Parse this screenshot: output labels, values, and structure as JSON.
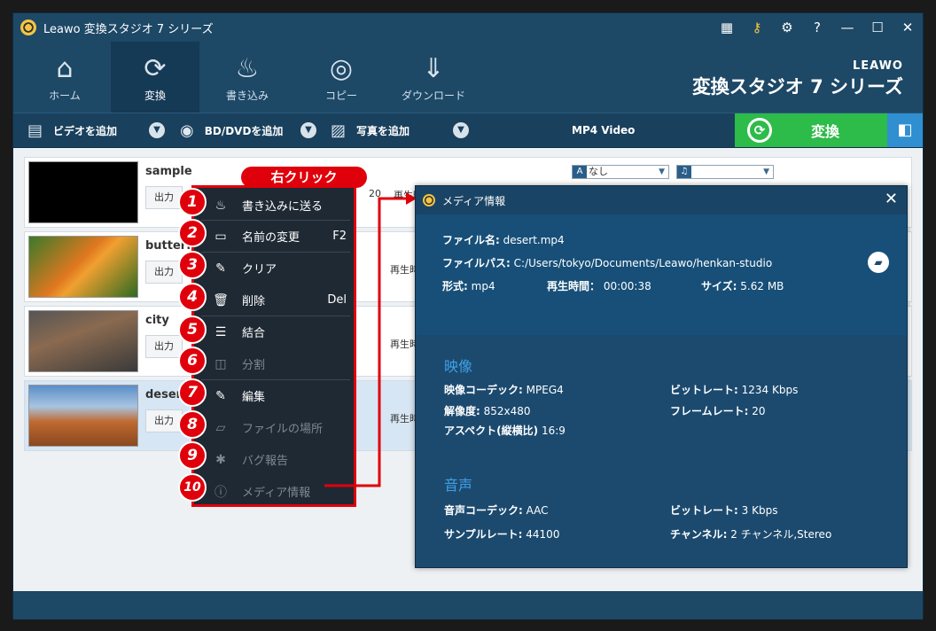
{
  "app": {
    "title": "Leawo 変換スタジオ 7 シリーズ"
  },
  "nav": [
    {
      "label": "ホーム",
      "icon": "home-icon"
    },
    {
      "label": "変換",
      "icon": "convert-icon"
    },
    {
      "label": "書き込み",
      "icon": "burn-icon"
    },
    {
      "label": "コピー",
      "icon": "copy-icon"
    },
    {
      "label": "ダウンロード",
      "icon": "download-icon"
    }
  ],
  "brand": {
    "logo": "LEAWO",
    "product": "変換スタジオ 7 シリーズ"
  },
  "toolbar": {
    "add_video": "ビデオを追加",
    "add_bd": "BD/DVDを追加",
    "add_photo": "写真を追加",
    "profile": "MP4 Video",
    "convert": "変換"
  },
  "files": [
    {
      "name": "sample",
      "out": "出力",
      "dur_label": "再生時間",
      "extra": "20"
    },
    {
      "name": "butterfly",
      "out": "出力",
      "dur_label": "再生時間"
    },
    {
      "name": "city",
      "out": "出力",
      "dur_label": "再生時間"
    },
    {
      "name": "desert",
      "out": "出力",
      "dur_label": "再生時間"
    }
  ],
  "subtitle_select": "なし",
  "callout": "右クリック",
  "context_menu": [
    {
      "label": "書き込みに送る",
      "shortcut": "",
      "num": "1"
    },
    {
      "label": "名前の変更",
      "shortcut": "F2",
      "num": "2"
    },
    {
      "label": "クリア",
      "shortcut": "",
      "num": "3"
    },
    {
      "label": "削除",
      "shortcut": "Del",
      "num": "4"
    },
    {
      "label": "結合",
      "shortcut": "",
      "num": "5"
    },
    {
      "label": "分割",
      "shortcut": "",
      "num": "6"
    },
    {
      "label": "編集",
      "shortcut": "",
      "num": "7"
    },
    {
      "label": "ファイルの場所",
      "shortcut": "",
      "num": "8"
    },
    {
      "label": "バグ報告",
      "shortcut": "",
      "num": "9"
    },
    {
      "label": "メディア情報",
      "shortcut": "",
      "num": "10"
    }
  ],
  "media_info": {
    "title": "メディア情報",
    "file_name_label": "ファイル名:",
    "file_name": "desert.mp4",
    "file_path_label": "ファイルパス:",
    "file_path": "C:/Users/tokyo/Documents/Leawo/henkan-studio",
    "format_label": "形式:",
    "format": "mp4",
    "duration_label": "再生時間：",
    "duration": "00:00:38",
    "size_label": "サイズ:",
    "size": "5.62 MB",
    "video_section": "映像",
    "video_codec_label": "映像コーデック:",
    "video_codec": "MPEG4",
    "resolution_label": "解像度:",
    "resolution": "852x480",
    "aspect_label": "アスペクト(縦横比)",
    "aspect": "16:9",
    "v_bitrate_label": "ビットレート:",
    "v_bitrate": "1234 Kbps",
    "framerate_label": "フレームレート:",
    "framerate": "20",
    "audio_section": "音声",
    "audio_codec_label": "音声コーデック:",
    "audio_codec": "AAC",
    "samplerate_label": "サンプルレート:",
    "samplerate": "44100",
    "a_bitrate_label": "ビットレート:",
    "a_bitrate": "3 Kbps",
    "channels_label": "チャンネル:",
    "channels": "2 チャンネル,Stereo"
  }
}
